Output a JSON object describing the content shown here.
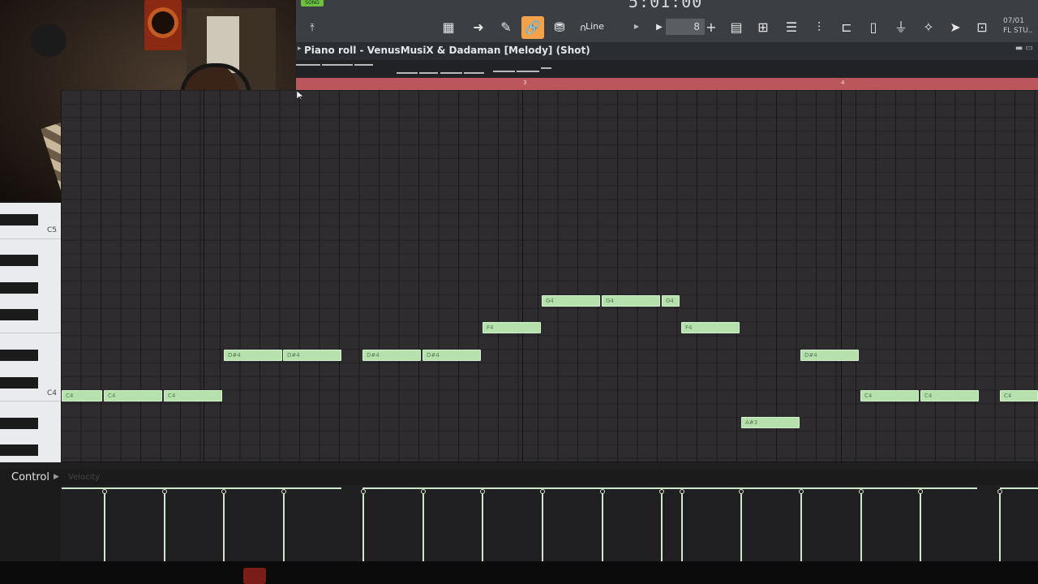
{
  "toolbar": {
    "song_badge": "SONG",
    "time": "5:01:00",
    "snap_mode": "Line",
    "step": "8",
    "date": "07/01",
    "app_short": "FL STU..",
    "add_symbol": "+",
    "link_color": "#f3a24a"
  },
  "window": {
    "title": "Piano roll - VenusMusiX & Dadaman [Melody] (Shot)"
  },
  "timeline": {
    "bar_labels": [
      "3",
      "4"
    ],
    "color": "#b9575d"
  },
  "keyboard": {
    "labels": [
      "C5",
      "C4"
    ]
  },
  "notes": [
    {
      "label": "C4"
    },
    {
      "label": "C4"
    },
    {
      "label": "C4"
    },
    {
      "label": "D#4"
    },
    {
      "label": "D#4"
    },
    {
      "label": "D#4"
    },
    {
      "label": "D#4"
    },
    {
      "label": "F4"
    },
    {
      "label": "G4"
    },
    {
      "label": "G4"
    },
    {
      "label": "G4"
    },
    {
      "label": "F4"
    },
    {
      "label": "A#3"
    },
    {
      "label": "D#4"
    },
    {
      "label": "C4"
    },
    {
      "label": "C4"
    },
    {
      "label": "C4"
    }
  ],
  "control": {
    "label": "Control",
    "parameter": "Velocity"
  },
  "colors": {
    "note": "#b6e1ad",
    "grid": "#2e2c2f"
  }
}
